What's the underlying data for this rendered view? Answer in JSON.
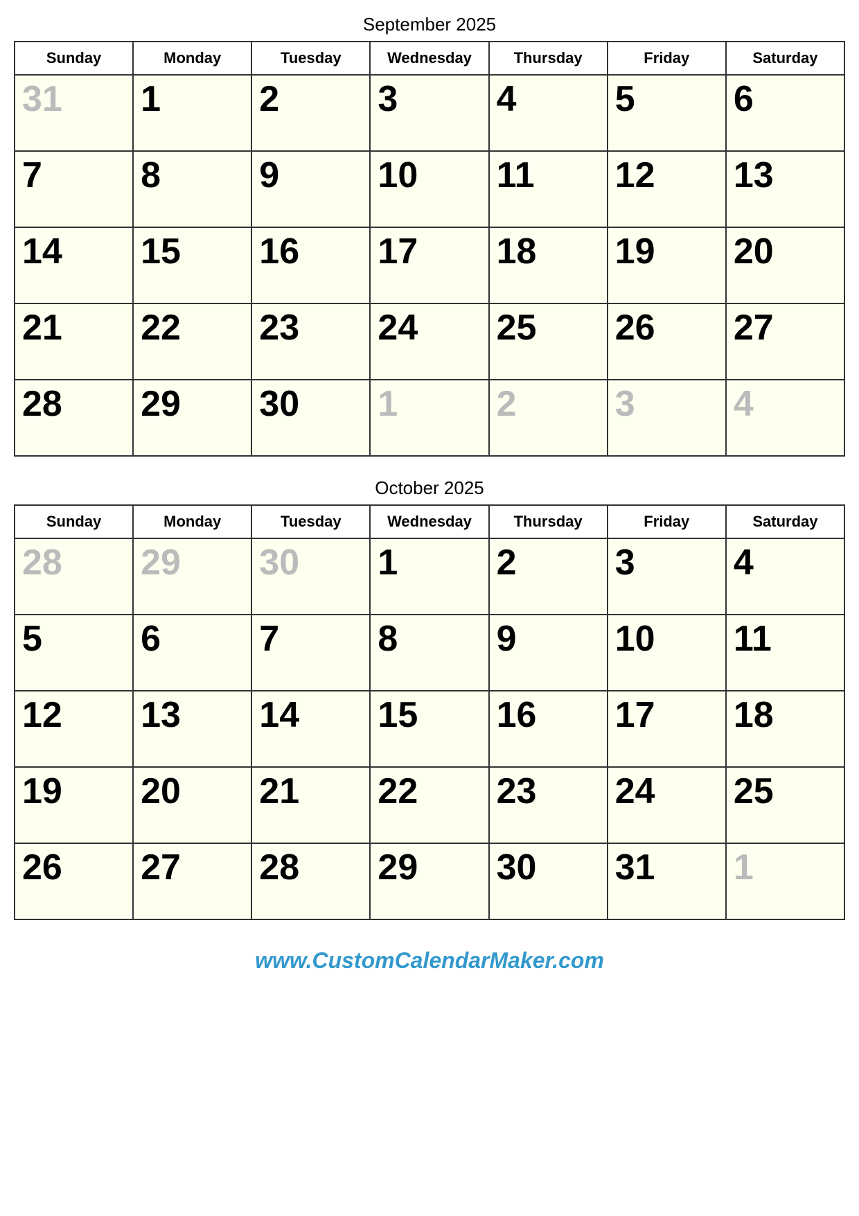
{
  "september": {
    "title": "September 2025",
    "headers": [
      "Sunday",
      "Monday",
      "Tuesday",
      "Wednesday",
      "Thursday",
      "Friday",
      "Saturday"
    ],
    "weeks": [
      [
        {
          "num": "31",
          "faded": true
        },
        {
          "num": "1",
          "faded": false
        },
        {
          "num": "2",
          "faded": false
        },
        {
          "num": "3",
          "faded": false
        },
        {
          "num": "4",
          "faded": false
        },
        {
          "num": "5",
          "faded": false
        },
        {
          "num": "6",
          "faded": false
        }
      ],
      [
        {
          "num": "7",
          "faded": false
        },
        {
          "num": "8",
          "faded": false
        },
        {
          "num": "9",
          "faded": false
        },
        {
          "num": "10",
          "faded": false
        },
        {
          "num": "11",
          "faded": false
        },
        {
          "num": "12",
          "faded": false
        },
        {
          "num": "13",
          "faded": false
        }
      ],
      [
        {
          "num": "14",
          "faded": false
        },
        {
          "num": "15",
          "faded": false
        },
        {
          "num": "16",
          "faded": false
        },
        {
          "num": "17",
          "faded": false
        },
        {
          "num": "18",
          "faded": false
        },
        {
          "num": "19",
          "faded": false
        },
        {
          "num": "20",
          "faded": false
        }
      ],
      [
        {
          "num": "21",
          "faded": false
        },
        {
          "num": "22",
          "faded": false
        },
        {
          "num": "23",
          "faded": false
        },
        {
          "num": "24",
          "faded": false
        },
        {
          "num": "25",
          "faded": false
        },
        {
          "num": "26",
          "faded": false
        },
        {
          "num": "27",
          "faded": false
        }
      ],
      [
        {
          "num": "28",
          "faded": false
        },
        {
          "num": "29",
          "faded": false
        },
        {
          "num": "30",
          "faded": false
        },
        {
          "num": "1",
          "faded": true
        },
        {
          "num": "2",
          "faded": true
        },
        {
          "num": "3",
          "faded": true
        },
        {
          "num": "4",
          "faded": true
        }
      ]
    ]
  },
  "october": {
    "title": "October 2025",
    "headers": [
      "Sunday",
      "Monday",
      "Tuesday",
      "Wednesday",
      "Thursday",
      "Friday",
      "Saturday"
    ],
    "weeks": [
      [
        {
          "num": "28",
          "faded": true
        },
        {
          "num": "29",
          "faded": true
        },
        {
          "num": "30",
          "faded": true
        },
        {
          "num": "1",
          "faded": false
        },
        {
          "num": "2",
          "faded": false
        },
        {
          "num": "3",
          "faded": false
        },
        {
          "num": "4",
          "faded": false
        }
      ],
      [
        {
          "num": "5",
          "faded": false
        },
        {
          "num": "6",
          "faded": false
        },
        {
          "num": "7",
          "faded": false
        },
        {
          "num": "8",
          "faded": false
        },
        {
          "num": "9",
          "faded": false
        },
        {
          "num": "10",
          "faded": false
        },
        {
          "num": "11",
          "faded": false
        }
      ],
      [
        {
          "num": "12",
          "faded": false
        },
        {
          "num": "13",
          "faded": false
        },
        {
          "num": "14",
          "faded": false
        },
        {
          "num": "15",
          "faded": false
        },
        {
          "num": "16",
          "faded": false
        },
        {
          "num": "17",
          "faded": false
        },
        {
          "num": "18",
          "faded": false
        }
      ],
      [
        {
          "num": "19",
          "faded": false
        },
        {
          "num": "20",
          "faded": false
        },
        {
          "num": "21",
          "faded": false
        },
        {
          "num": "22",
          "faded": false
        },
        {
          "num": "23",
          "faded": false
        },
        {
          "num": "24",
          "faded": false
        },
        {
          "num": "25",
          "faded": false
        }
      ],
      [
        {
          "num": "26",
          "faded": false
        },
        {
          "num": "27",
          "faded": false
        },
        {
          "num": "28",
          "faded": false
        },
        {
          "num": "29",
          "faded": false
        },
        {
          "num": "30",
          "faded": false
        },
        {
          "num": "31",
          "faded": false
        },
        {
          "num": "1",
          "faded": true
        }
      ]
    ]
  },
  "footer": {
    "text": "www.CustomCalendarMaker.com"
  }
}
